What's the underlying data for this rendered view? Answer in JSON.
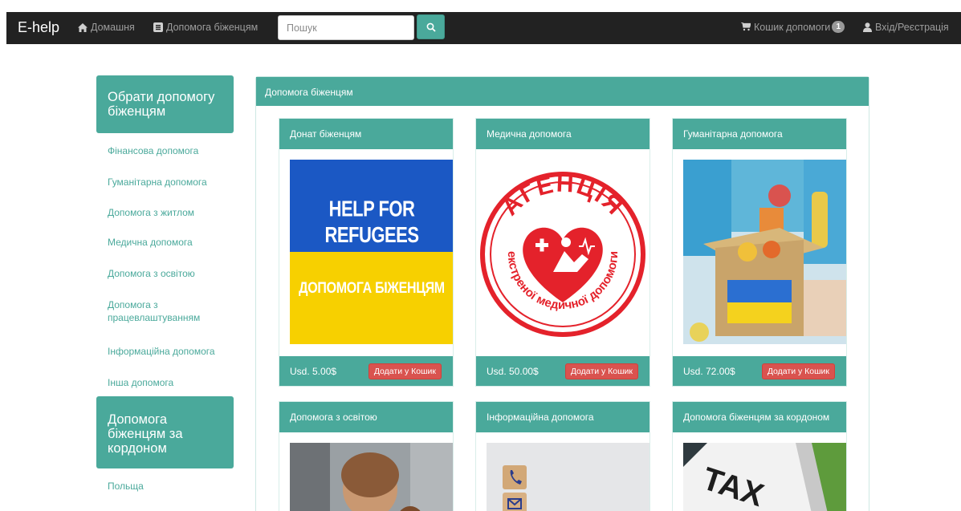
{
  "navbar": {
    "brand": "E-help",
    "home": "Домашня",
    "refugee_help": "Допомога біженцям",
    "search_placeholder": "Пошук",
    "cart": "Кошик допомоги",
    "cart_count": "1",
    "login": "Вхід/Реєстрація"
  },
  "sidebar": {
    "heading_1": "Обрати допомогу біженцям",
    "items": [
      "Фінансова допомога",
      "Гуманітарна допомога",
      "Допомога з житлом",
      "Медична допомога",
      "Допомога з освітою",
      "Допомога з працевлаштуванням",
      "Інформаційна допомога",
      "Інша допомога"
    ],
    "heading_2": "Допомога біженцям за кордоном",
    "abroad_items": [
      "Польща"
    ]
  },
  "main": {
    "title": "Допомога біженцям",
    "cards": [
      {
        "title": "Донат біженцям",
        "price": "Usd. 5.00$",
        "button": "Додати у Кошик",
        "image_text_1": "HELP FOR REFUGEES",
        "image_text_2": "ДОПОМОГА БІЖЕНЦЯМ"
      },
      {
        "title": "Медична допомога",
        "price": "Usd. 50.00$",
        "button": "Додати у Кошик",
        "logo_text_top": "АГЕНЦІЯ",
        "logo_text_bottom": "екстреної медичної допомоги"
      },
      {
        "title": "Гуманітарна допомога",
        "price": "Usd. 72.00$",
        "button": "Додати у Кошик"
      },
      {
        "title": "Допомога з освітою"
      },
      {
        "title": "Інформаційна допомога"
      },
      {
        "title": "Допомога біженцям за кордоном",
        "image_text": "TAX"
      }
    ]
  },
  "colors": {
    "accent": "#4aa99b",
    "navbar": "#222222",
    "danger": "#d9534f"
  },
  "icons": [
    "home-icon",
    "list-icon",
    "search-icon",
    "cart-icon",
    "user-icon"
  ]
}
